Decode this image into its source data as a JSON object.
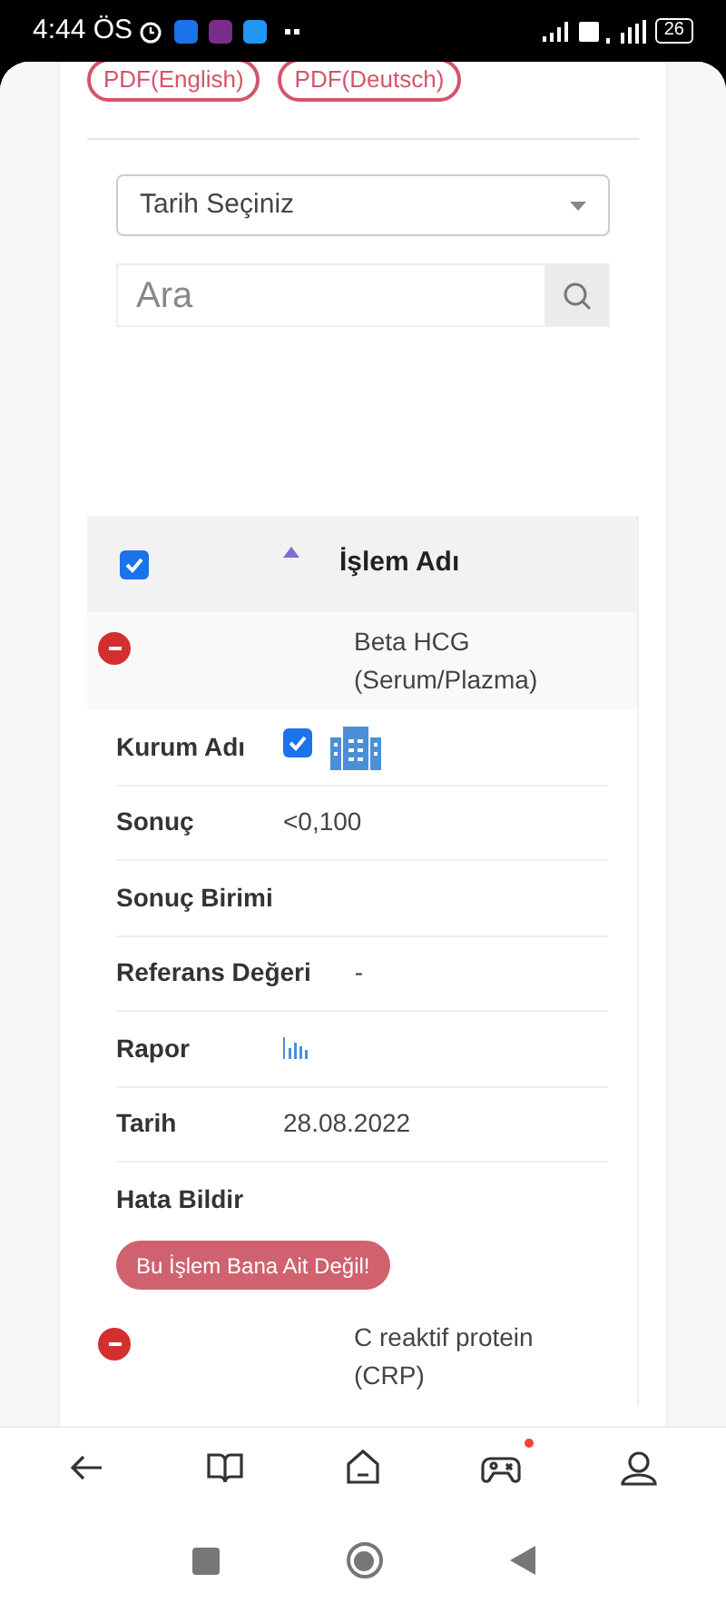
{
  "status_bar": {
    "time": "4:44 ÖS",
    "battery": "26"
  },
  "pdf_buttons": [
    "PDF(English)",
    "PDF(Deutsch)"
  ],
  "date_select": {
    "value": "Tarih Seçiniz"
  },
  "search": {
    "placeholder": "Ara"
  },
  "table": {
    "header": {
      "checked": true,
      "column": "İşlem Adı"
    },
    "rows": [
      {
        "name": "Beta HCG (Serum/Plazma)",
        "expanded": true,
        "details": [
          {
            "kind": "checkbox",
            "label": "Kurum Adı",
            "checked": true
          },
          {
            "kind": "text",
            "label": "Sonuç",
            "value": "<0,100"
          },
          {
            "kind": "text",
            "label": "Sonuç Birimi"
          },
          {
            "kind": "text",
            "label": "Referans Değeri",
            "value": "-"
          },
          {
            "kind": "report",
            "label": "Rapor"
          },
          {
            "kind": "text",
            "label": "Tarih",
            "value": "28.08.2022"
          },
          {
            "kind": "button",
            "label": "Hata Bildir",
            "button": "Bu İşlem Bana Ait Değil!"
          }
        ]
      },
      {
        "name": "C reaktif protein (CRP)",
        "expanded": true
      }
    ]
  },
  "bottom_nav": [
    {
      "kind": "back"
    },
    {
      "kind": "book"
    },
    {
      "kind": "home"
    },
    {
      "kind": "game",
      "badge": true
    },
    {
      "kind": "profile"
    }
  ]
}
